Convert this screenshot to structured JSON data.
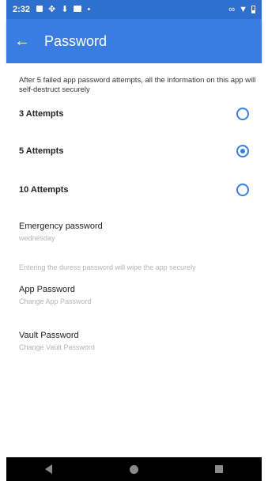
{
  "status_bar": {
    "time": "2:32",
    "icons": [
      "notification-icon",
      "sync-icon",
      "download-icon",
      "mail-icon",
      "dot-icon"
    ],
    "right_icons": [
      "link-icon",
      "wifi-icon",
      "battery-icon"
    ]
  },
  "app_bar": {
    "title": "Password",
    "back_glyph": "←"
  },
  "info_text": "After 5 failed app password attempts, all the information on this app will self-destruct securely",
  "options": [
    {
      "label": "3 Attempts",
      "selected": false
    },
    {
      "label": "5 Attempts",
      "selected": true
    },
    {
      "label": "10 Attempts",
      "selected": false
    }
  ],
  "emergency": {
    "title": "Emergency password",
    "value": "wednesday",
    "note": "Entering the duress password will wipe the app securely"
  },
  "app_password": {
    "title": "App Password",
    "sub": "Change App Password"
  },
  "vault_password": {
    "title": "Vault Password",
    "sub": "Change Vault Password"
  },
  "colors": {
    "status_bar": "#2f6fcd",
    "app_bar": "#3a7de0",
    "accent": "#3a7de0"
  }
}
